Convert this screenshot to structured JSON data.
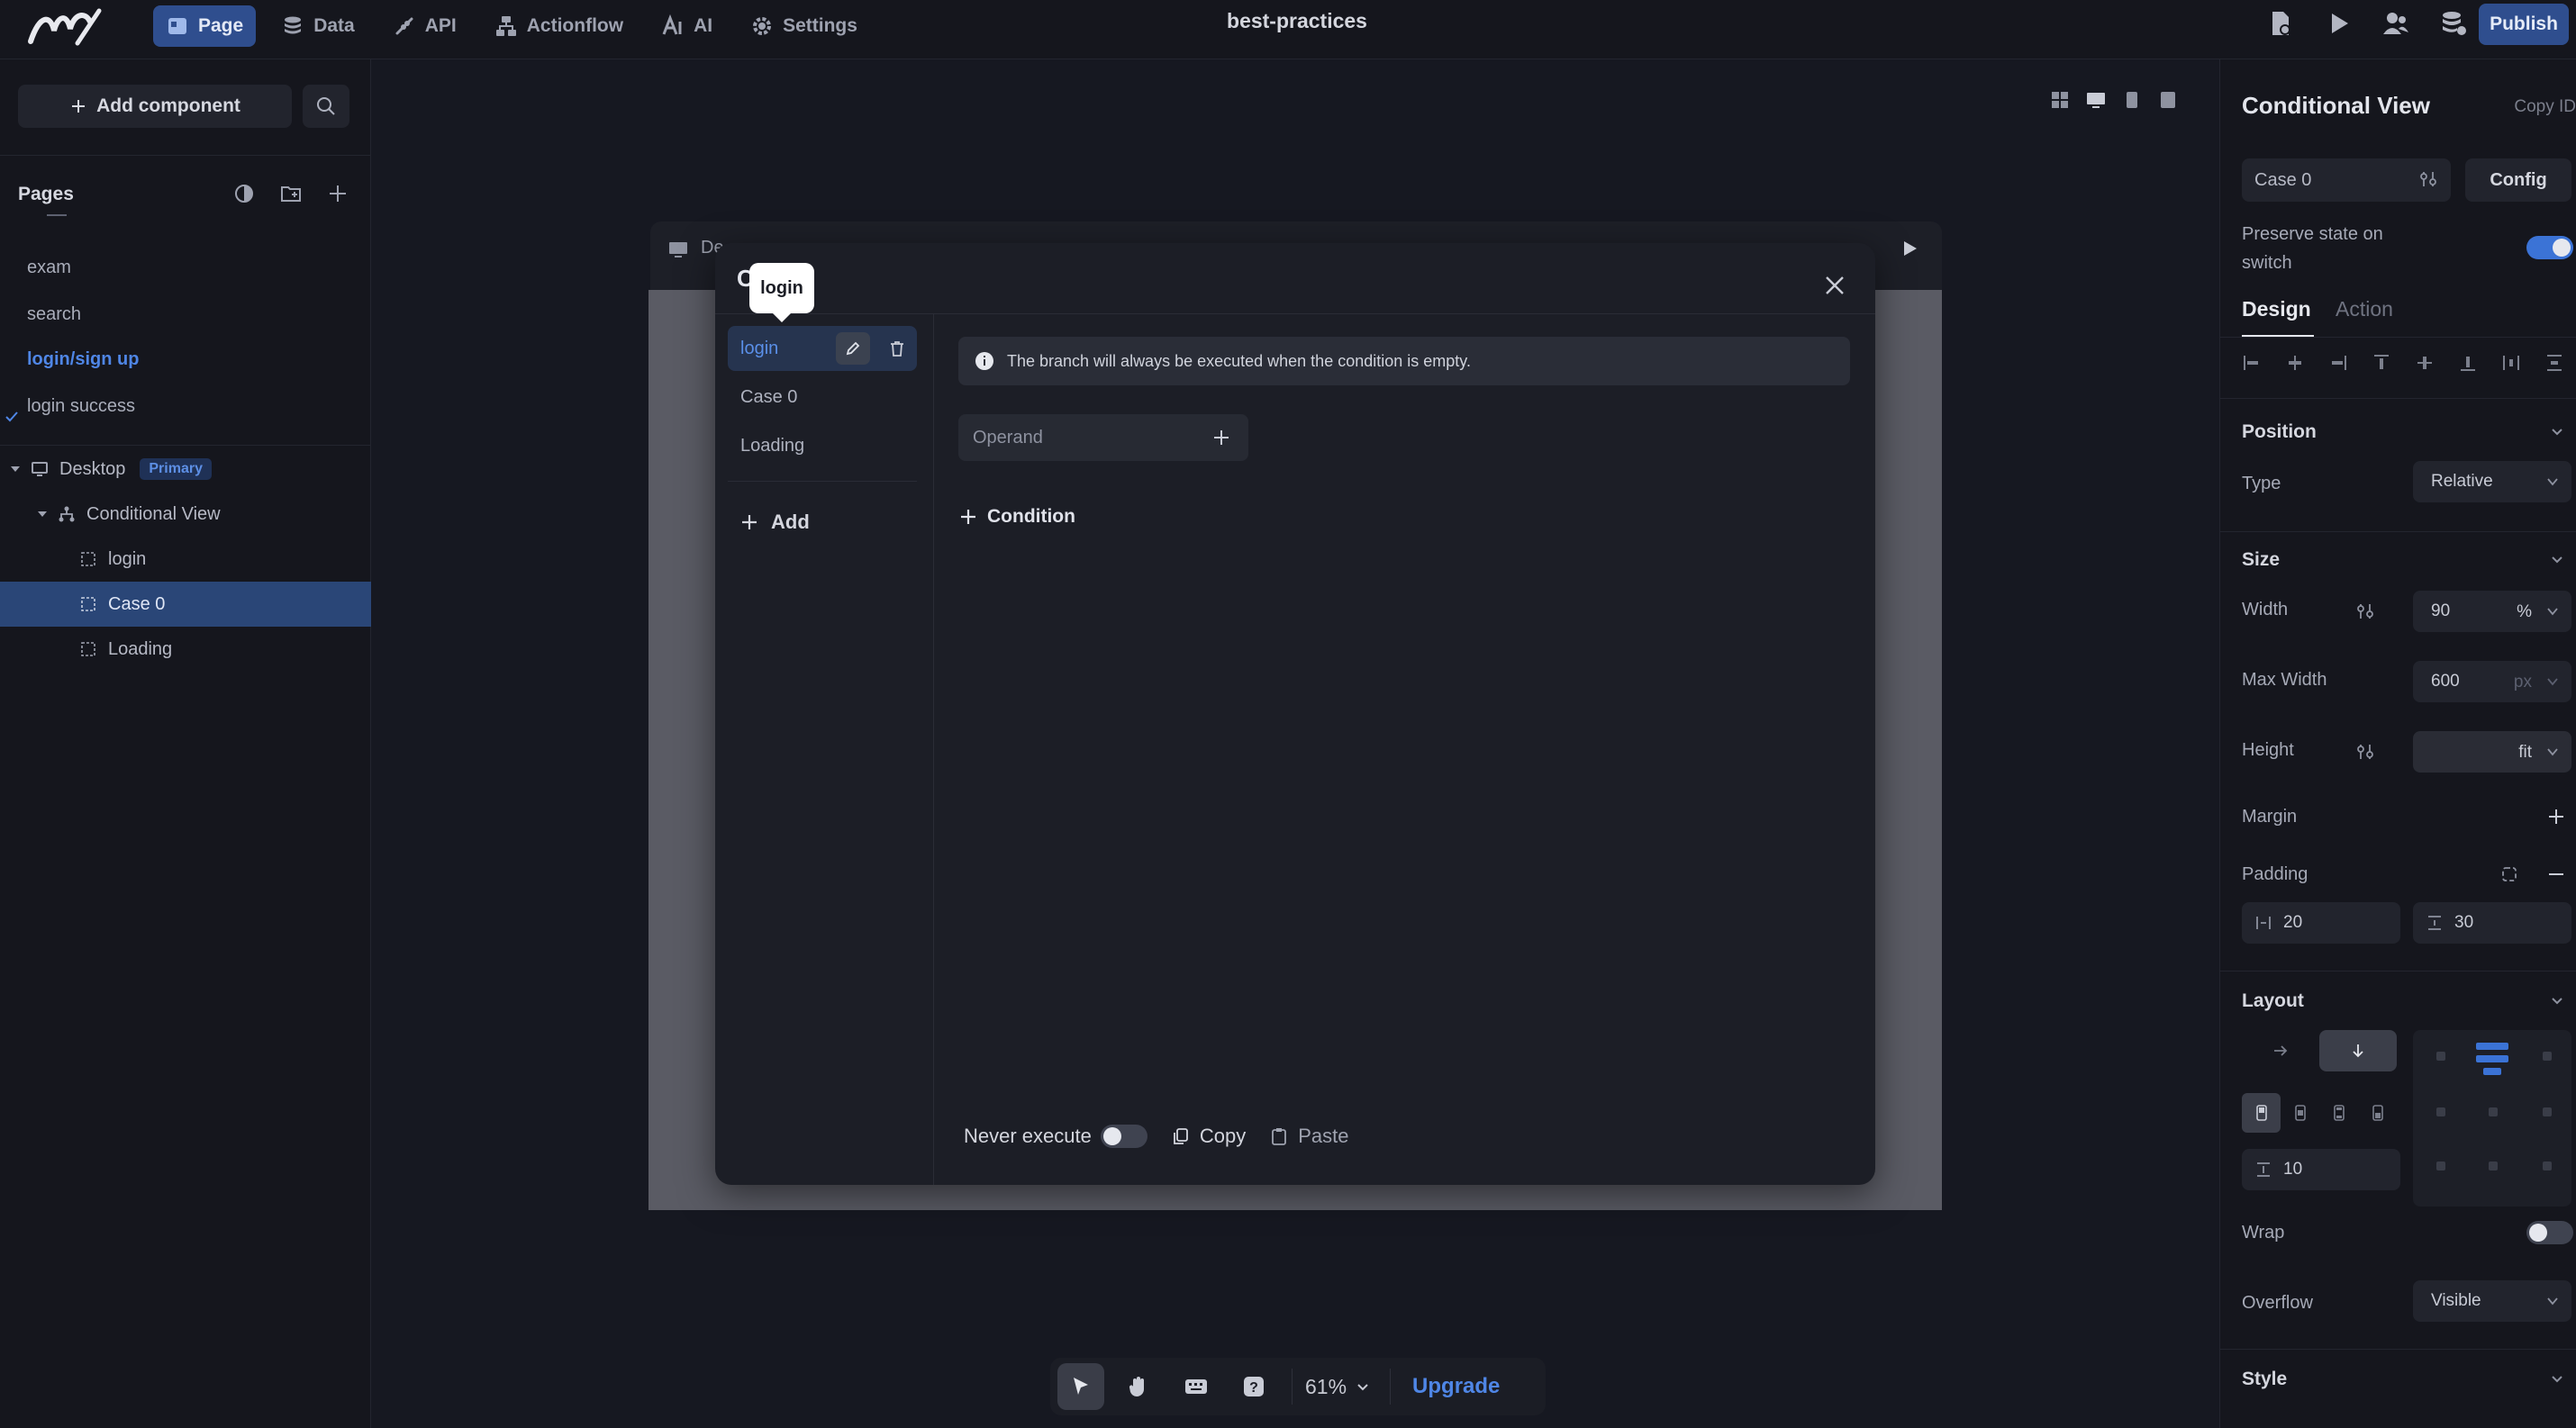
{
  "topbar": {
    "nav": [
      {
        "label": "Page",
        "icon": "page-icon",
        "active": true
      },
      {
        "label": "Data",
        "icon": "database-icon",
        "active": false
      },
      {
        "label": "API",
        "icon": "api-icon",
        "active": false
      },
      {
        "label": "Actionflow",
        "icon": "actionflow-icon",
        "active": false
      },
      {
        "label": "AI",
        "icon": "ai-icon",
        "active": false
      },
      {
        "label": "Settings",
        "icon": "gear-icon",
        "active": false
      }
    ],
    "app_title": "best-practices",
    "publish_label": "Publish"
  },
  "left_panel": {
    "add_component_label": "Add component",
    "pages_title": "Pages",
    "pages": [
      {
        "label": "exam",
        "active": false
      },
      {
        "label": "search",
        "active": false
      },
      {
        "label": "login/sign up",
        "active": true
      },
      {
        "label": "login success",
        "active": false
      }
    ],
    "tree": {
      "desktop_label": "Desktop",
      "desktop_badge": "Primary",
      "conditional_view_label": "Conditional View",
      "children": [
        "login",
        "Case 0",
        "Loading"
      ]
    }
  },
  "canvas": {
    "frame_label": "De",
    "modal": {
      "title_stub": "C",
      "tooltip": "login",
      "cases": [
        "login",
        "Case 0",
        "Loading"
      ],
      "add_label": "Add",
      "info_text": "The branch will always be executed when the condition is empty.",
      "operand_placeholder": "Operand",
      "condition_label": "Condition",
      "never_execute_label": "Never execute",
      "never_execute_on": false,
      "copy_label": "Copy",
      "paste_label": "Paste"
    },
    "zoom_label": "61%",
    "upgrade_label": "Upgrade"
  },
  "right_panel": {
    "title": "Conditional View",
    "copy_id_label": "Copy ID",
    "case_select": "Case 0",
    "config_label": "Config",
    "preserve_state_label": "Preserve state on switch",
    "preserve_state_on": true,
    "tabs": {
      "design": "Design",
      "action": "Action"
    },
    "position": {
      "title": "Position",
      "type_label": "Type",
      "type_value": "Relative"
    },
    "size": {
      "title": "Size",
      "width_label": "Width",
      "width_value": "90",
      "width_unit": "%",
      "max_width_label": "Max Width",
      "max_width_value": "600",
      "max_width_unit": "px",
      "height_label": "Height",
      "height_value": "fit"
    },
    "margin_label": "Margin",
    "padding": {
      "label": "Padding",
      "horizontal": "20",
      "vertical": "30"
    },
    "layout": {
      "title": "Layout",
      "gap_value": "10"
    },
    "wrap_label": "Wrap",
    "wrap_on": false,
    "overflow": {
      "label": "Overflow",
      "value": "Visible"
    },
    "style_title": "Style"
  },
  "colors": {
    "accent": "#4f86e6",
    "active_nav": "#2f4e8e",
    "background": "#161821"
  }
}
